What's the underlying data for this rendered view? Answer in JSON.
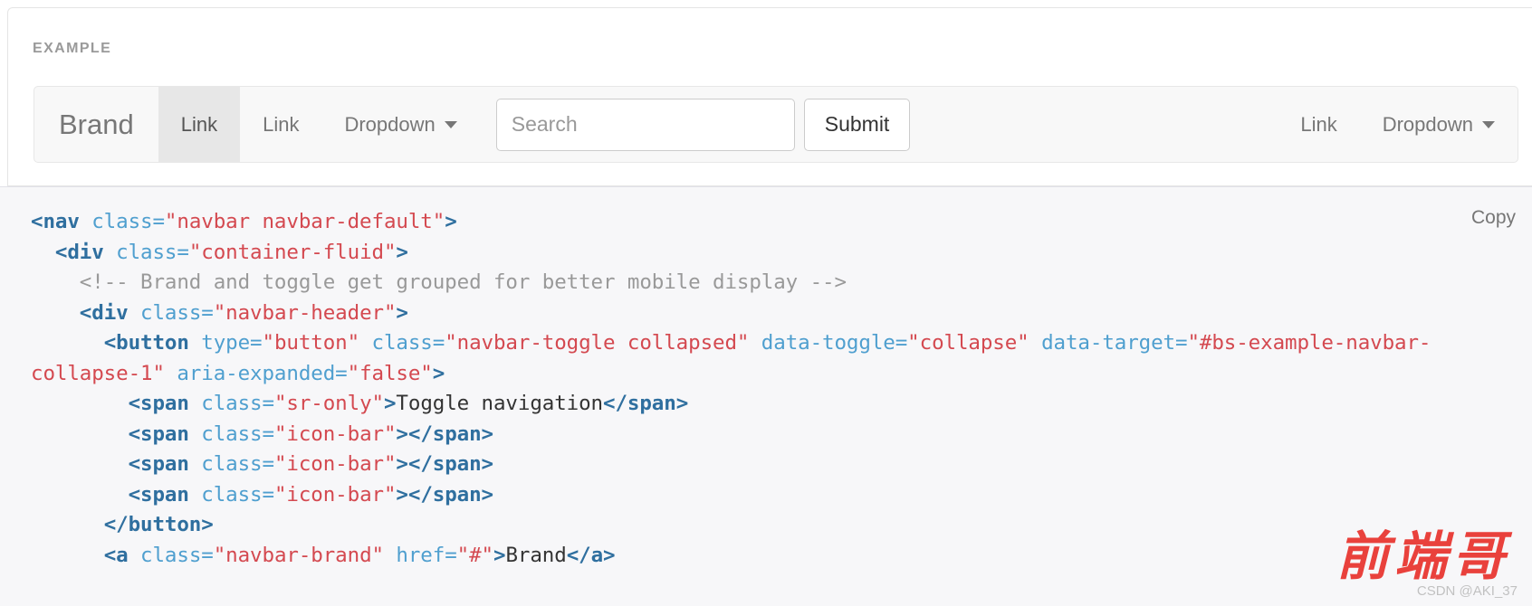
{
  "example": {
    "label": "EXAMPLE"
  },
  "navbar": {
    "brand": "Brand",
    "left_items": [
      {
        "label": "Link",
        "type": "link",
        "active": true
      },
      {
        "label": "Link",
        "type": "link",
        "active": false
      },
      {
        "label": "Dropdown",
        "type": "dropdown",
        "active": false
      }
    ],
    "form": {
      "search_placeholder": "Search",
      "search_value": "",
      "submit_label": "Submit"
    },
    "right_items": [
      {
        "label": "Link",
        "type": "link",
        "active": false
      },
      {
        "label": "Dropdown",
        "type": "dropdown",
        "active": false
      }
    ]
  },
  "code_panel": {
    "copy_label": "Copy",
    "language": "html",
    "lines": [
      [
        {
          "t": "tag",
          "s": "<nav "
        },
        {
          "t": "attr",
          "s": "class="
        },
        {
          "t": "val",
          "s": "\"navbar navbar-default\""
        },
        {
          "t": "tag",
          "s": ">"
        }
      ],
      [
        {
          "t": "txt",
          "s": "  "
        },
        {
          "t": "tag",
          "s": "<div "
        },
        {
          "t": "attr",
          "s": "class="
        },
        {
          "t": "val",
          "s": "\"container-fluid\""
        },
        {
          "t": "tag",
          "s": ">"
        }
      ],
      [
        {
          "t": "txt",
          "s": "    "
        },
        {
          "t": "cmt",
          "s": "<!-- Brand and toggle get grouped for better mobile display -->"
        }
      ],
      [
        {
          "t": "txt",
          "s": "    "
        },
        {
          "t": "tag",
          "s": "<div "
        },
        {
          "t": "attr",
          "s": "class="
        },
        {
          "t": "val",
          "s": "\"navbar-header\""
        },
        {
          "t": "tag",
          "s": ">"
        }
      ],
      [
        {
          "t": "txt",
          "s": "      "
        },
        {
          "t": "tag",
          "s": "<button "
        },
        {
          "t": "attr",
          "s": "type="
        },
        {
          "t": "val",
          "s": "\"button\""
        },
        {
          "t": "attr",
          "s": " class="
        },
        {
          "t": "val",
          "s": "\"navbar-toggle collapsed\""
        },
        {
          "t": "attr",
          "s": " data-toggle="
        },
        {
          "t": "val",
          "s": "\"collapse\""
        },
        {
          "t": "attr",
          "s": " data-target="
        },
        {
          "t": "val",
          "s": "\"#bs-example-navbar-collapse-1\""
        },
        {
          "t": "attr",
          "s": " aria-expanded="
        },
        {
          "t": "val",
          "s": "\"false\""
        },
        {
          "t": "tag",
          "s": ">"
        }
      ],
      [
        {
          "t": "txt",
          "s": "        "
        },
        {
          "t": "tag",
          "s": "<span "
        },
        {
          "t": "attr",
          "s": "class="
        },
        {
          "t": "val",
          "s": "\"sr-only\""
        },
        {
          "t": "tag",
          "s": ">"
        },
        {
          "t": "txt",
          "s": "Toggle navigation"
        },
        {
          "t": "tag",
          "s": "</span>"
        }
      ],
      [
        {
          "t": "txt",
          "s": "        "
        },
        {
          "t": "tag",
          "s": "<span "
        },
        {
          "t": "attr",
          "s": "class="
        },
        {
          "t": "val",
          "s": "\"icon-bar\""
        },
        {
          "t": "tag",
          "s": "></span>"
        }
      ],
      [
        {
          "t": "txt",
          "s": "        "
        },
        {
          "t": "tag",
          "s": "<span "
        },
        {
          "t": "attr",
          "s": "class="
        },
        {
          "t": "val",
          "s": "\"icon-bar\""
        },
        {
          "t": "tag",
          "s": "></span>"
        }
      ],
      [
        {
          "t": "txt",
          "s": "        "
        },
        {
          "t": "tag",
          "s": "<span "
        },
        {
          "t": "attr",
          "s": "class="
        },
        {
          "t": "val",
          "s": "\"icon-bar\""
        },
        {
          "t": "tag",
          "s": "></span>"
        }
      ],
      [
        {
          "t": "txt",
          "s": "      "
        },
        {
          "t": "tag",
          "s": "</button>"
        }
      ],
      [
        {
          "t": "txt",
          "s": "      "
        },
        {
          "t": "tag",
          "s": "<a "
        },
        {
          "t": "attr",
          "s": "class="
        },
        {
          "t": "val",
          "s": "\"navbar-brand\""
        },
        {
          "t": "attr",
          "s": " href="
        },
        {
          "t": "val",
          "s": "\"#\""
        },
        {
          "t": "tag",
          "s": ">"
        },
        {
          "t": "txt",
          "s": "Brand"
        },
        {
          "t": "tag",
          "s": "</a>"
        }
      ]
    ]
  },
  "watermark": {
    "brand_cn": "前端哥",
    "credit": "CSDN @AKI_37"
  }
}
